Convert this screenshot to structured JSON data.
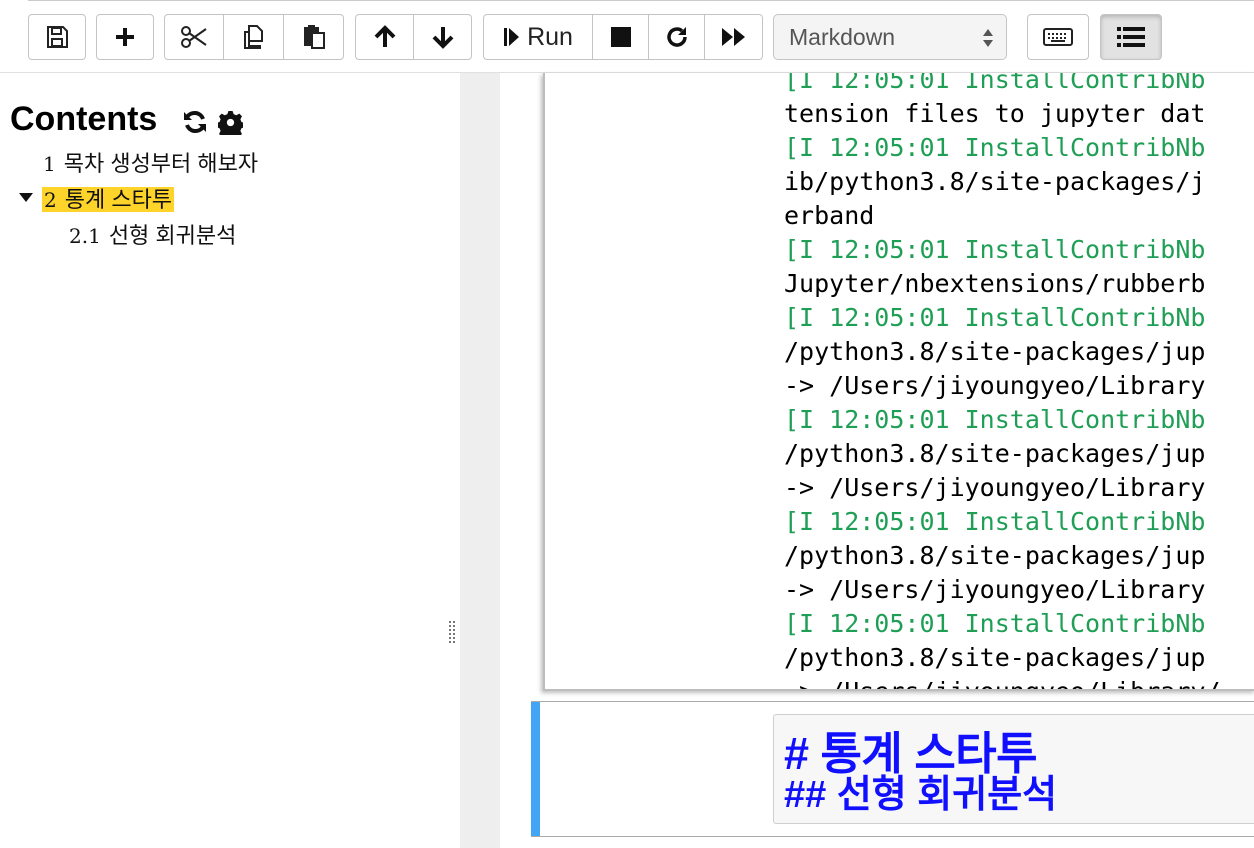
{
  "toolbar": {
    "run_label": "Run",
    "cell_type": "Markdown",
    "buttons": [
      "save-icon",
      "plus-icon",
      "scissors-icon",
      "copy-icon",
      "paste-icon",
      "arrow-up-icon",
      "arrow-down-icon",
      "run-icon",
      "stop-icon",
      "restart-icon",
      "fast-forward-icon",
      "keyboard-icon",
      "list-icon"
    ]
  },
  "toc": {
    "title": "Contents",
    "items": [
      {
        "num": "1",
        "label": "목차 생성부터 해보자"
      },
      {
        "num": "2",
        "label": "통계 스타투"
      },
      {
        "num": "2.1",
        "label": "선형 회귀분석"
      }
    ],
    "highlight_color": "#ffd42a"
  },
  "output": {
    "lines": [
      {
        "prefix": "[I 12:05:01 InstallContribNb",
        "text": ""
      },
      {
        "prefix": "",
        "text": "tension files to jupyter dat"
      },
      {
        "prefix": "[I 12:05:01 InstallContribNb",
        "text": ""
      },
      {
        "prefix": "",
        "text": "ib/python3.8/site-packages/j"
      },
      {
        "prefix": "",
        "text": "erband"
      },
      {
        "prefix": "[I 12:05:01 InstallContribNb",
        "text": ""
      },
      {
        "prefix": "",
        "text": "Jupyter/nbextensions/rubberb"
      },
      {
        "prefix": "[I 12:05:01 InstallContribNb",
        "text": ""
      },
      {
        "prefix": "",
        "text": "/python3.8/site-packages/jup"
      },
      {
        "prefix": "",
        "text": "-> /Users/jiyoungyeo/Library"
      },
      {
        "prefix": "[I 12:05:01 InstallContribNb",
        "text": ""
      },
      {
        "prefix": "",
        "text": "/python3.8/site-packages/jup"
      },
      {
        "prefix": "",
        "text": "-> /Users/jiyoungyeo/Library"
      },
      {
        "prefix": "[I 12:05:01 InstallContribNb",
        "text": ""
      },
      {
        "prefix": "",
        "text": "/python3.8/site-packages/jup"
      },
      {
        "prefix": "",
        "text": "-> /Users/jiyoungyeo/Library"
      },
      {
        "prefix": "[I 12:05:01 InstallContribNb",
        "text": ""
      },
      {
        "prefix": "",
        "text": "/python3.8/site-packages/jup"
      },
      {
        "prefix": "",
        "text": "-> /Users/jiyoungyeo/Library/"
      }
    ],
    "log_color": "#1f9f55"
  },
  "markdown_cell": {
    "h1": "# 통계 스타투",
    "h2": "## 선형 회귀분석",
    "heading_color": "#1010ff",
    "selected_bar_color": "#42a5f5"
  }
}
